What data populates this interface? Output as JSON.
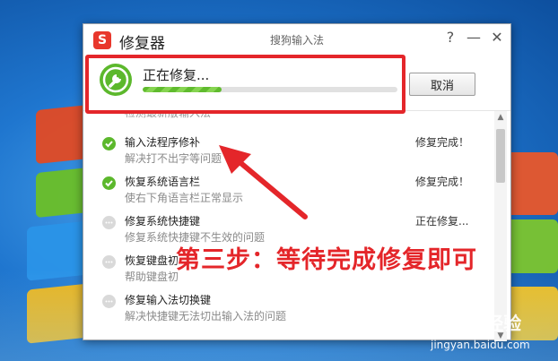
{
  "window": {
    "title": "修复器",
    "app_name": "搜狗输入法",
    "logo_letter": "S",
    "help_label": "?",
    "minimize_label": "—",
    "close_label": "✕"
  },
  "progress": {
    "status": "正在修复...",
    "fraction": 0.31,
    "cancel_label": "取消"
  },
  "repair_list": {
    "partial_top_text": "检测最新版输入法",
    "items": [
      {
        "title": "输入法程序修补",
        "description": "解决打不出字等问题",
        "status": "修复完成！",
        "state": "done"
      },
      {
        "title": "恢复系统语言栏",
        "description": "使右下角语言栏正常显示",
        "status": "修复完成！",
        "state": "done"
      },
      {
        "title": "修复系统快捷键",
        "description": "修复系统快捷键不生效的问题",
        "status": "正在修复...",
        "state": "pending"
      },
      {
        "title": "恢复键盘初",
        "description": "帮助键盘初",
        "status": "",
        "state": "pending"
      },
      {
        "title": "修复输入法切换键",
        "description": "解决快捷键无法切出输入法的问题",
        "status": "",
        "state": "pending"
      }
    ]
  },
  "annotation": {
    "text": "第三步：等待完成修复即可"
  },
  "watermark": {
    "brand": "Baidu 经验",
    "url": "jingyan.baidu.com"
  },
  "colors": {
    "accent_green": "#5cb82c",
    "highlight_red": "#e4262a",
    "logo_red": "#e8372c"
  },
  "icons": {
    "repair": "wrench-icon",
    "done": "check-circle-icon",
    "pending": "ellipsis-circle-icon"
  }
}
